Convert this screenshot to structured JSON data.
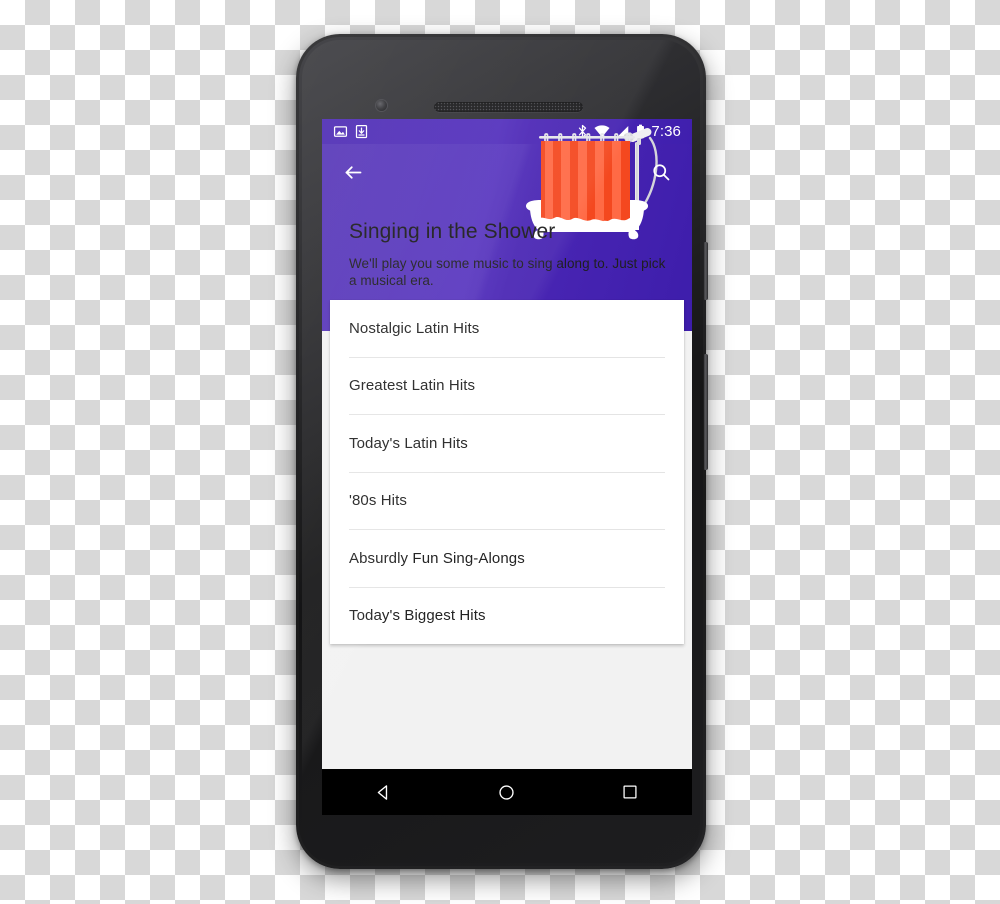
{
  "device": {
    "name": "android-phone",
    "front_camera": "front-camera",
    "earpiece": "earpiece-speaker",
    "bottom_speaker": "bottom-speaker",
    "power_button": "power-button",
    "volume_button": "volume-rocker"
  },
  "status_bar": {
    "time": "7:36",
    "left_icons": [
      {
        "name": "screenshot-icon",
        "label": "screenshot"
      },
      {
        "name": "download-icon",
        "label": "download"
      }
    ],
    "right_icons": [
      {
        "name": "bluetooth-icon",
        "label": "bluetooth"
      },
      {
        "name": "wifi-icon",
        "label": "wifi"
      },
      {
        "name": "cellular-signal-icon",
        "label": "signal"
      },
      {
        "name": "battery-icon",
        "label": "battery"
      }
    ],
    "background_color": "#5330bd"
  },
  "action_bar": {
    "back_label": "Back",
    "search_label": "Search"
  },
  "hero": {
    "title": "Singing in the Shower",
    "subtitle": "We'll play you some music to sing along to. Just pick a musical era.",
    "illustration": "shower-curtain-bathtub-illustration",
    "background_color": "#5330bd",
    "curtain_color": "#f4481f",
    "curtain_color_light": "#ff6a45",
    "tub_color": "#ffffff"
  },
  "list": {
    "items": [
      {
        "label": "Nostalgic Latin Hits"
      },
      {
        "label": "Greatest Latin Hits"
      },
      {
        "label": "Today's Latin Hits"
      },
      {
        "label": "'80s Hits"
      },
      {
        "label": "Absurdly Fun Sing-Alongs"
      },
      {
        "label": "Today's Biggest Hits"
      }
    ]
  },
  "nav_bar": {
    "buttons": [
      {
        "name": "nav-back-button",
        "label": "Back"
      },
      {
        "name": "nav-home-button",
        "label": "Home"
      },
      {
        "name": "nav-recents-button",
        "label": "Recents"
      }
    ]
  }
}
